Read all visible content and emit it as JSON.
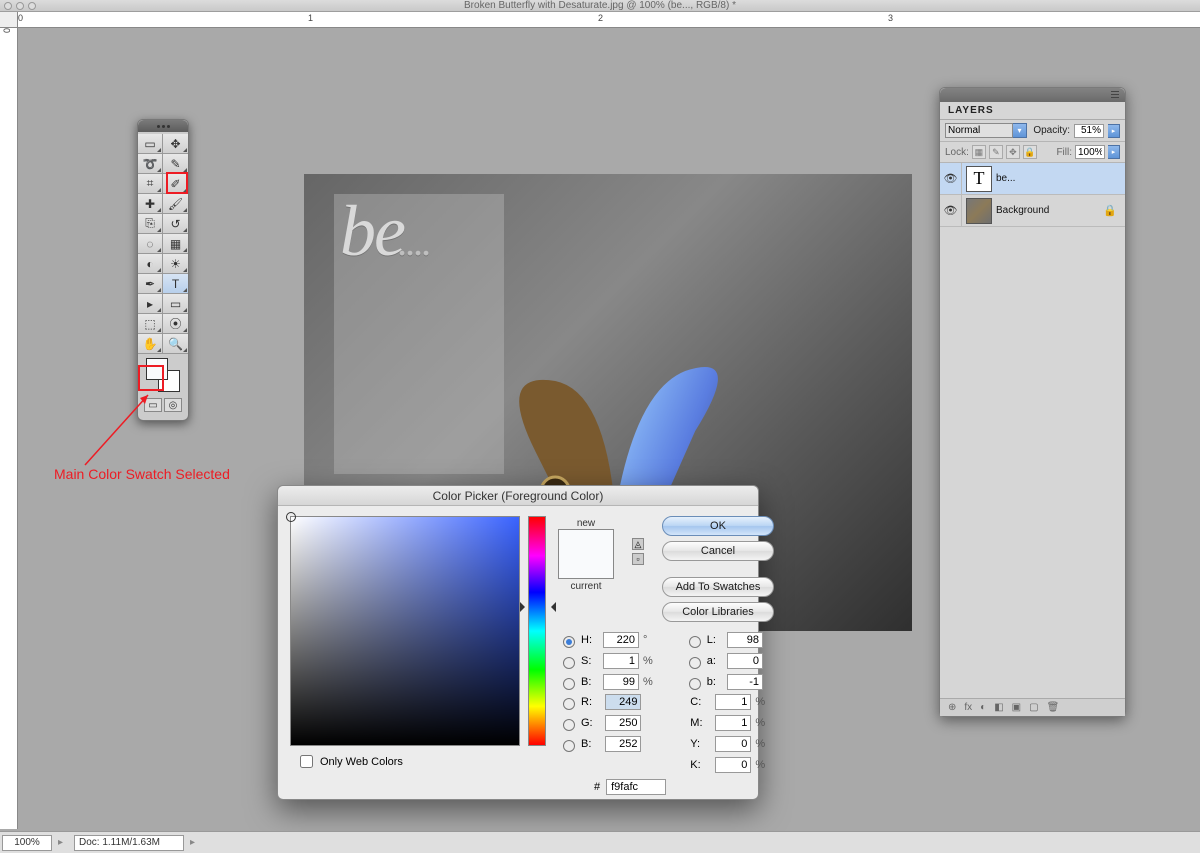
{
  "title": "Broken Butterfly with Desaturate.jpg @ 100% (be..., RGB/8) *",
  "ruler": {
    "h": [
      "0",
      "1",
      "2",
      "3"
    ],
    "v": [
      "0"
    ]
  },
  "statusbar": {
    "zoom": "100%",
    "doc_label": "Doc:",
    "doc_size": "1.11M/1.63M"
  },
  "annotation": "Main Color Swatch Selected",
  "document": {
    "text_layer": "be"
  },
  "tools": {
    "names": [
      "marquee-tool",
      "move-tool",
      "lasso-tool",
      "quick-select-tool",
      "crop-tool",
      "eyedropper-tool",
      "healing-tool",
      "brush-tool",
      "stamp-tool",
      "history-brush-tool",
      "eraser-tool",
      "gradient-tool",
      "blur-tool",
      "dodge-tool",
      "pen-tool",
      "type-tool",
      "path-select-tool",
      "shape-tool",
      "3d-tool",
      "3d-camera-tool",
      "hand-tool",
      "zoom-tool"
    ],
    "glyphs": [
      "▭",
      "✥",
      "➰",
      "✎",
      "⌗",
      "✐",
      "✚",
      "🖌",
      "⎘",
      "↺",
      "◌",
      "▦",
      "◐",
      "☀",
      "✒",
      "T",
      "▸",
      "▭",
      "⬚",
      "⦿",
      "✋",
      "🔍"
    ],
    "selected_index": 15,
    "quickmask_glyph": "◎"
  },
  "layers": {
    "tab": "LAYERS",
    "blend_mode": "Normal",
    "opacity_label": "Opacity:",
    "opacity": "51%",
    "fill_label": "Fill:",
    "fill": "100%",
    "lock_label": "Lock:",
    "rows": [
      {
        "name": "be...",
        "type": "T",
        "selected": true,
        "locked": false
      },
      {
        "name": "Background",
        "type": "bg",
        "selected": false,
        "locked": true
      }
    ],
    "footer_icons": [
      "⊕",
      "fx",
      "◐",
      "◧",
      "◩",
      "▢",
      "🗑"
    ]
  },
  "picker": {
    "title": "Color Picker (Foreground Color)",
    "new_label": "new",
    "current_label": "current",
    "buttons": {
      "ok": "OK",
      "cancel": "Cancel",
      "add": "Add To Swatches",
      "libs": "Color Libraries"
    },
    "hsb": {
      "H": "220",
      "S": "1",
      "B": "99",
      "H_unit": "°",
      "pct": "%"
    },
    "lab": {
      "L": "98",
      "a": "0",
      "b": "-1"
    },
    "rgb": {
      "R": "249",
      "G": "250",
      "B": "252"
    },
    "cmyk": {
      "C": "1",
      "M": "1",
      "Y": "0",
      "K": "0",
      "pct": "%"
    },
    "hex_label": "#",
    "hex": "f9fafc",
    "only_web": "Only Web Colors"
  }
}
